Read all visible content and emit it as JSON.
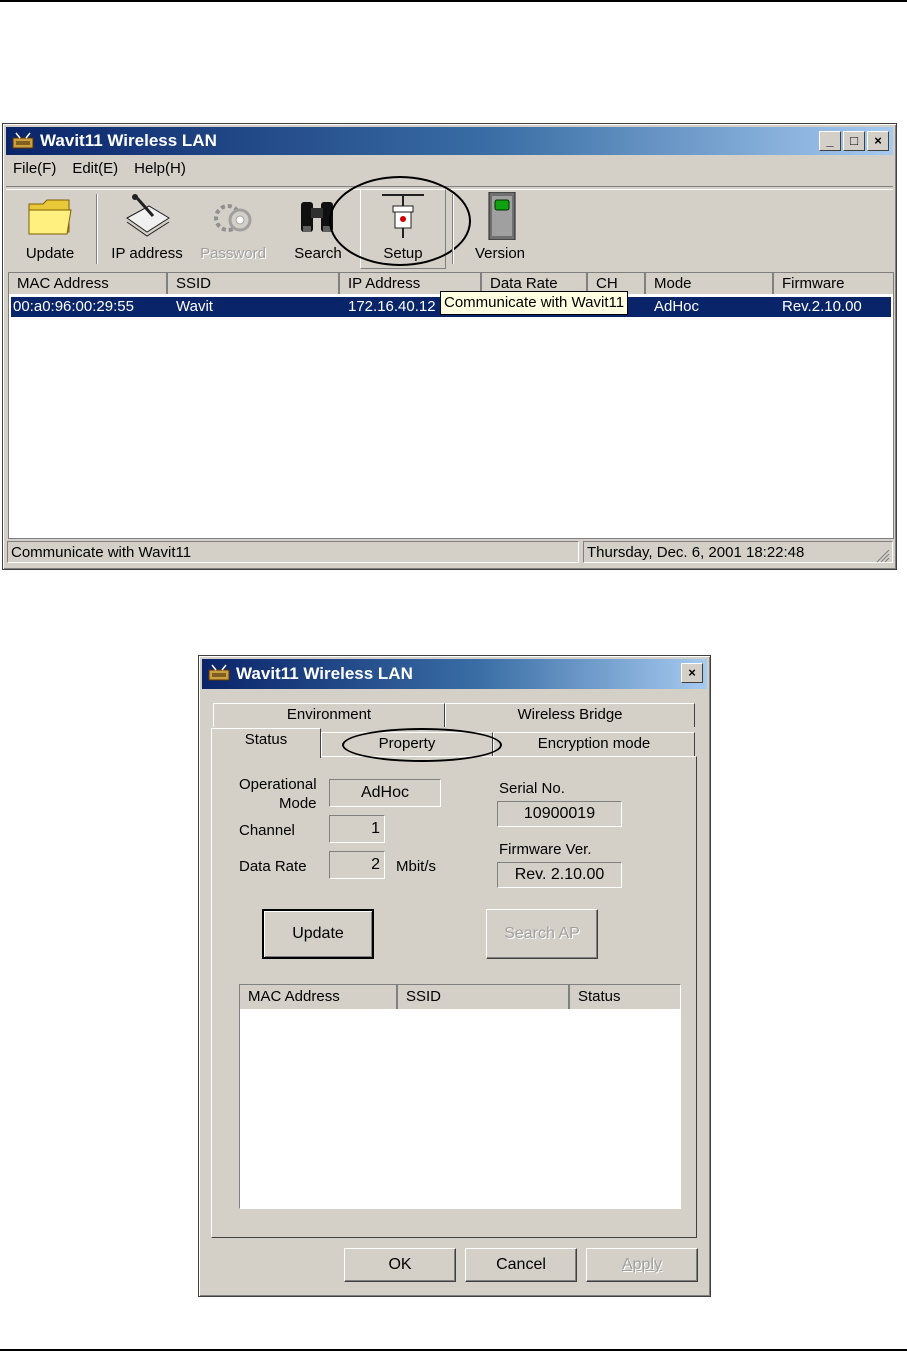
{
  "main_window": {
    "title": "Wavit11 Wireless LAN",
    "caption_buttons": {
      "minimize": "_",
      "maximize": "□",
      "close": "×"
    },
    "menu": [
      "File(F)",
      "Edit(E)",
      "Help(H)"
    ],
    "toolbar": {
      "update": "Update",
      "ip_address": "IP address",
      "password": "Password",
      "search": "Search",
      "setup": "Setup",
      "version": "Version"
    },
    "columns": [
      "MAC Address",
      "SSID",
      "IP Address",
      "Data Rate",
      "CH",
      "Mode",
      "Firmware"
    ],
    "rows": [
      {
        "mac": "00:a0:96:00:29:55",
        "ssid": "Wavit",
        "ip": "172.16.40.12",
        "mode": "AdHoc",
        "firmware": "Rev.2.10.00"
      }
    ],
    "tooltip": "Communicate with Wavit11",
    "status": {
      "left": "Communicate with Wavit11",
      "right": "Thursday,  Dec.  6, 2001  18:22:48"
    }
  },
  "dialog": {
    "title": "Wavit11 Wireless LAN",
    "close": "×",
    "tabs_back": [
      "Environment",
      "Wireless Bridge"
    ],
    "tabs_front": [
      "Status",
      "Property",
      "Encryption mode"
    ],
    "labels": {
      "operational": "Operational",
      "mode": "Mode",
      "channel": "Channel",
      "data_rate": "Data Rate",
      "mbits": "Mbit/s",
      "serial": "Serial No.",
      "firmware": "Firmware Ver."
    },
    "values": {
      "mode": "AdHoc",
      "channel": "1",
      "data_rate": "2",
      "serial": "10900019",
      "firmware": "Rev. 2.10.00"
    },
    "buttons": {
      "update": "Update",
      "search_ap": "Search AP",
      "ok": "OK",
      "cancel": "Cancel",
      "apply": "Apply"
    },
    "ap_columns": [
      "MAC Address",
      "SSID",
      "Status"
    ]
  }
}
